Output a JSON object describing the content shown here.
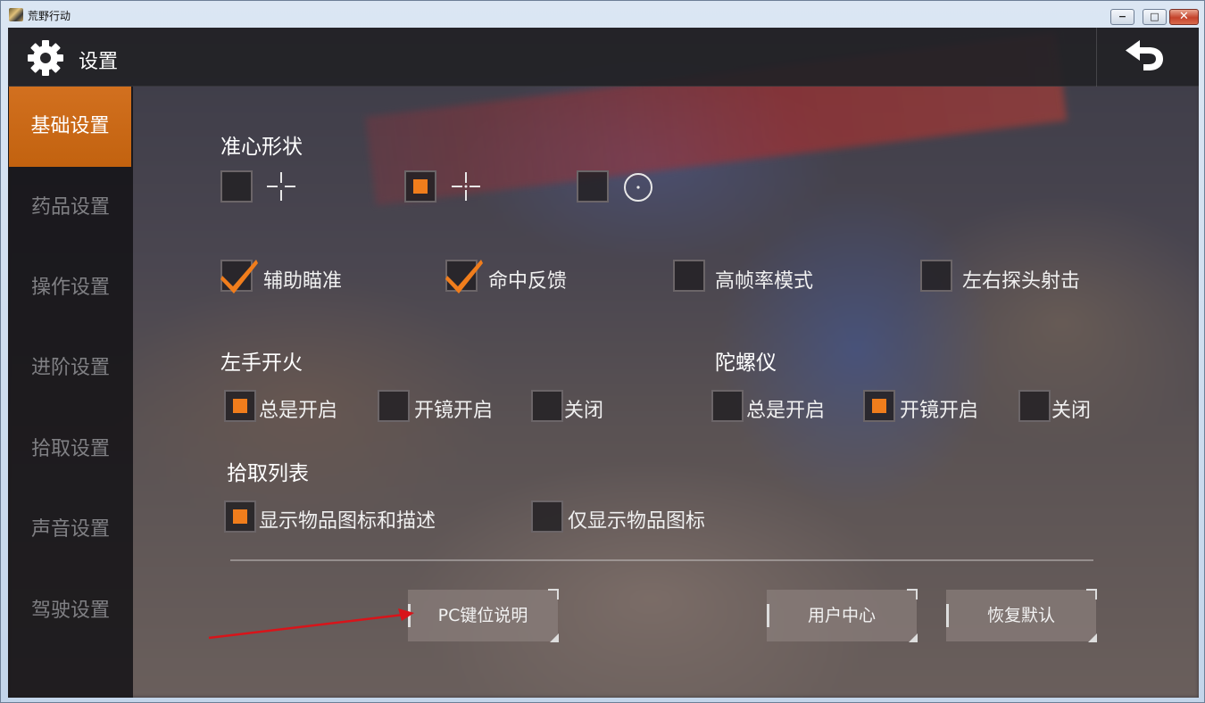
{
  "window": {
    "title": "荒野行动",
    "minimize": "−",
    "maximize": "□",
    "close": "✕"
  },
  "header": {
    "title": "设置",
    "settings_icon": "gear-icon",
    "back_icon": "back-arrow-icon"
  },
  "sidebar": {
    "items": [
      {
        "label": "基础设置",
        "active": true
      },
      {
        "label": "药品设置",
        "active": false
      },
      {
        "label": "操作设置",
        "active": false
      },
      {
        "label": "进阶设置",
        "active": false
      },
      {
        "label": "拾取设置",
        "active": false
      },
      {
        "label": "声音设置",
        "active": false
      },
      {
        "label": "驾驶设置",
        "active": false
      }
    ]
  },
  "crosshair": {
    "title": "准心形状",
    "options": [
      {
        "icon": "crosshair-cross-icon",
        "selected": false
      },
      {
        "icon": "crosshair-cross-dot-icon",
        "selected": true
      },
      {
        "icon": "crosshair-circle-icon",
        "selected": false
      }
    ]
  },
  "toggles": [
    {
      "label": "辅助瞄准",
      "checked": true
    },
    {
      "label": "命中反馈",
      "checked": true
    },
    {
      "label": "高帧率模式",
      "checked": false
    },
    {
      "label": "左右探头射击",
      "checked": false
    }
  ],
  "left_fire": {
    "title": "左手开火",
    "options": [
      {
        "label": "总是开启",
        "selected": true
      },
      {
        "label": "开镜开启",
        "selected": false
      },
      {
        "label": "关闭",
        "selected": false
      }
    ]
  },
  "gyroscope": {
    "title": "陀螺仪",
    "options": [
      {
        "label": "总是开启",
        "selected": false
      },
      {
        "label": "开镜开启",
        "selected": true
      },
      {
        "label": "关闭",
        "selected": false
      }
    ]
  },
  "pickup_list": {
    "title": "拾取列表",
    "options": [
      {
        "label": "显示物品图标和描述",
        "selected": true
      },
      {
        "label": "仅显示物品图标",
        "selected": false
      }
    ]
  },
  "buttons": {
    "pc_keys": "PC键位说明",
    "user_center": "用户中心",
    "restore_default": "恢复默认"
  },
  "colors": {
    "accent": "#f07d1c",
    "sidebar_active": "#c96816",
    "annotation_arrow": "#d8141a"
  }
}
